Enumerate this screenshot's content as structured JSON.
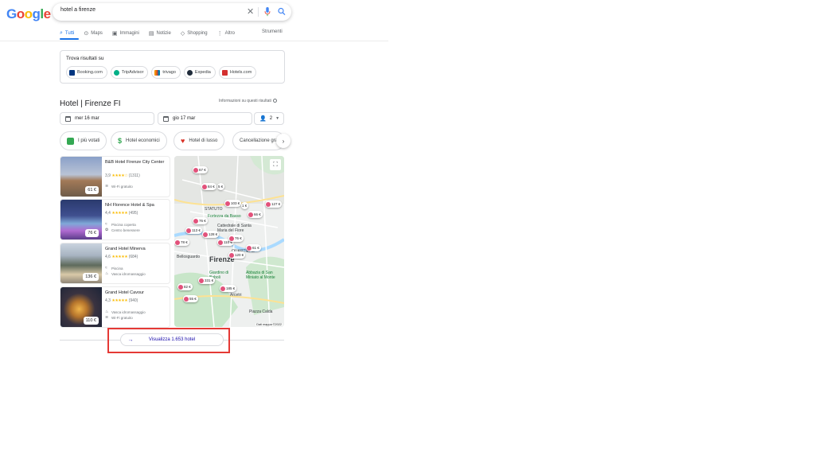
{
  "header": {
    "logo": [
      "G",
      "o",
      "o",
      "g",
      "l",
      "e"
    ],
    "logo_colors": [
      "#4285f4",
      "#ea4335",
      "#fbbc05",
      "#4285f4",
      "#34a853",
      "#ea4335"
    ],
    "query": "hotel a firenze",
    "clear_symbol": "✕"
  },
  "tabs": [
    {
      "label": "Tutti",
      "icon": "search-icon",
      "active": true
    },
    {
      "label": "Maps",
      "icon": "map-pin-icon"
    },
    {
      "label": "Immagini",
      "icon": "image-icon"
    },
    {
      "label": "Notizie",
      "icon": "news-icon"
    },
    {
      "label": "Shopping",
      "icon": "tag-icon"
    },
    {
      "label": "Altro",
      "icon": "more-icon"
    }
  ],
  "tools_label": "Strumenti",
  "find_results": {
    "title": "Trova risultati su",
    "sites": [
      {
        "label": "Booking.com",
        "color": "#003580"
      },
      {
        "label": "TripAdvisor",
        "color": "#00af87"
      },
      {
        "label": "trivago",
        "color": "#e8891c"
      },
      {
        "label": "Expedia",
        "color": "#1f2b3a"
      },
      {
        "label": "Hotels.com",
        "color": "#d32f2f"
      }
    ]
  },
  "hotels_section": {
    "title": "Hotel | Firenze FI",
    "info_label": "Informazioni su questi risultati",
    "checkin": "mer 16 mar",
    "checkout": "gio 17 mar",
    "guests": "2",
    "filters": [
      "I più votati",
      "Hotel economici",
      "Hotel di lusso",
      "Cancellazione gra"
    ]
  },
  "hotels": [
    {
      "name": "B&B Hotel Firenze City Center",
      "rating": "3,9",
      "stars": "★★★★☆",
      "reviews": "(1311)",
      "price": "61 €",
      "amenities": [
        "Wi-Fi gratuito"
      ],
      "amenity_icons": [
        "wifi-icon"
      ]
    },
    {
      "name": "NH Florence Hotel & Spa",
      "rating": "4,4",
      "stars": "★★★★★",
      "reviews": "(495)",
      "price": "76 €",
      "amenities": [
        "Piscina coperta",
        "Centro benessere"
      ],
      "amenity_icons": [
        "pool-icon",
        "spa-icon"
      ]
    },
    {
      "name": "Grand Hotel Minerva",
      "rating": "4,6",
      "stars": "★★★★★",
      "reviews": "(684)",
      "price": "136 €",
      "amenities": [
        "Piscina",
        "Vasca idromassaggio"
      ],
      "amenity_icons": [
        "pool-icon",
        "hot-tub-icon"
      ]
    },
    {
      "name": "Grand Hotel Cavour",
      "rating": "4,3",
      "stars": "★★★★★",
      "reviews": "(940)",
      "price": "110 €",
      "amenities": [
        "Vasca idromassaggio",
        "Wi-Fi gratuito"
      ],
      "amenity_icons": [
        "hot-tub-icon",
        "wifi-icon"
      ]
    }
  ],
  "map": {
    "labels": [
      "STATUTO",
      "Fortezza da Basso",
      "Cattedrale di Santa Maria del Fiore",
      "Bellosguardo",
      "QUARTIERE",
      "Firenze",
      "Giardino di Boboli",
      "Abbazia di San Miniato al Monte",
      "Arcetri",
      "Piazza Calda"
    ],
    "pins": [
      "67 €",
      "84 €",
      "5 €",
      "103 €",
      "1 €",
      "66 €",
      "127 €",
      "76 €",
      "113 €",
      "128 €",
      "78 €",
      "110 €",
      "76 €",
      "61 €",
      "120 €",
      "82 €",
      "331 €",
      "185 €",
      "55 €"
    ],
    "attribution": "Dati mappa ©2022"
  },
  "view_all": "Visualizza 1.653 hotel"
}
